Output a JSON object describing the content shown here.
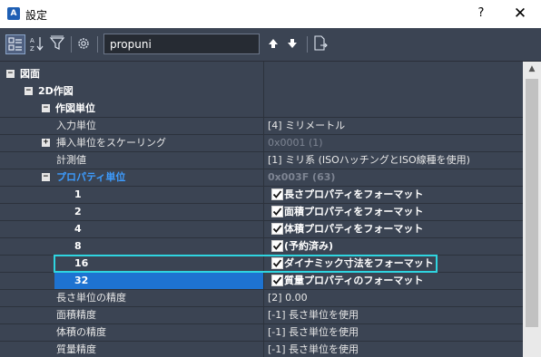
{
  "window": {
    "title": "設定",
    "app_icon_letter": "A",
    "help_label": "?",
    "close_label": "✕"
  },
  "toolbar": {
    "search_value": "propuni",
    "icons": [
      "categorized-view-icon",
      "alphabetical-sort-icon",
      "filter-icon",
      "settings-gear-icon",
      "previous-arrow-icon",
      "next-arrow-icon",
      "export-icon"
    ],
    "prev_glyph": "🡅",
    "next_glyph": "🡇"
  },
  "rows": [
    {
      "name": "図面",
      "value": "",
      "expander": "−"
    },
    {
      "name": "2D作図",
      "value": "",
      "expander": "−"
    },
    {
      "name": "作図単位",
      "value": "",
      "expander": "−"
    },
    {
      "name": "入力単位",
      "value": "[4] ミリメートル"
    },
    {
      "name": "挿入単位をスケーリング",
      "value": "0x0001 (1)",
      "expander": "+"
    },
    {
      "name": "計測値",
      "value": "[1] ミリ系 (ISOハッチングとISO線種を使用)"
    },
    {
      "name": "プロパティ単位",
      "value": "0x003F (63)",
      "expander": "−"
    },
    {
      "name": "1",
      "value": "長さプロパティをフォーマット",
      "checked": true
    },
    {
      "name": "2",
      "value": "面積プロパティをフォーマット",
      "checked": true
    },
    {
      "name": "4",
      "value": "体積プロパティをフォーマット",
      "checked": true
    },
    {
      "name": "8",
      "value": "(予約済み)",
      "checked": true
    },
    {
      "name": "16",
      "value": "ダイナミック寸法をフォーマット",
      "checked": true
    },
    {
      "name": "32",
      "value": "質量プロパティのフォーマット",
      "checked": true
    },
    {
      "name": "長さ単位の精度",
      "value": "[2] 0.00"
    },
    {
      "name": "面積精度",
      "value": "[-1] 長さ単位を使用"
    },
    {
      "name": "体積の精度",
      "value": "[-1] 長さ単位を使用"
    },
    {
      "name": "質量精度",
      "value": "[-1] 長さ単位を使用"
    }
  ],
  "colors": {
    "highlight_border": "#2fd5e0",
    "selected_row": "#1e73d1",
    "link_blue": "#3d9cff"
  }
}
